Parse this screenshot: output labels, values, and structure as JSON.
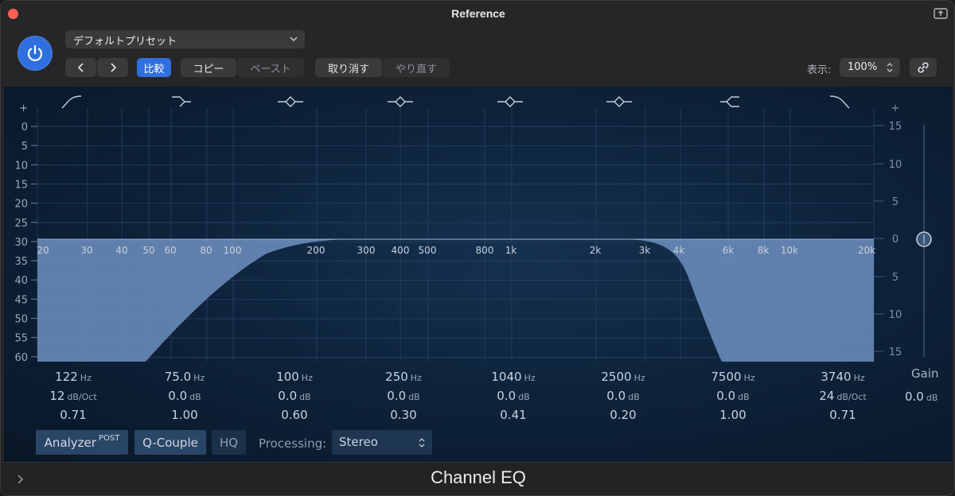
{
  "window": {
    "title": "Reference"
  },
  "header": {
    "preset": "デフォルトプリセット",
    "compare_label": "比較",
    "copy_label": "コピー",
    "paste_label": "ペースト",
    "undo_label": "取り消す",
    "redo_label": "やり直す",
    "zoom_label": "表示:",
    "zoom_value": "100%"
  },
  "graph": {
    "left_scale": [
      "+",
      "0",
      "5",
      "10",
      "15",
      "20",
      "25",
      "30",
      "35",
      "40",
      "45",
      "50",
      "55",
      "60"
    ],
    "right_scale": [
      "+",
      "15",
      "10",
      "5",
      "0",
      "5",
      "10",
      "15"
    ],
    "freq_labels": [
      "20",
      "30",
      "40",
      "50",
      "60",
      "80",
      "100",
      "200",
      "300",
      "400",
      "500",
      "800",
      "1k",
      "2k",
      "3k",
      "4k",
      "6k",
      "8k",
      "10k",
      "20k"
    ],
    "band_icons": [
      "low-cut-icon",
      "low-shelf-icon",
      "bell-icon",
      "bell-icon",
      "bell-icon",
      "bell-icon",
      "high-shelf-icon",
      "high-cut-icon"
    ]
  },
  "bands": [
    {
      "freq": "122",
      "freq_unit": "Hz",
      "gain": "12",
      "gain_unit": "dB/Oct",
      "q": "0.71"
    },
    {
      "freq": "75.0",
      "freq_unit": "Hz",
      "gain": "0.0",
      "gain_unit": "dB",
      "q": "1.00"
    },
    {
      "freq": "100",
      "freq_unit": "Hz",
      "gain": "0.0",
      "gain_unit": "dB",
      "q": "0.60"
    },
    {
      "freq": "250",
      "freq_unit": "Hz",
      "gain": "0.0",
      "gain_unit": "dB",
      "q": "0.30"
    },
    {
      "freq": "1040",
      "freq_unit": "Hz",
      "gain": "0.0",
      "gain_unit": "dB",
      "q": "0.41"
    },
    {
      "freq": "2500",
      "freq_unit": "Hz",
      "gain": "0.0",
      "gain_unit": "dB",
      "q": "0.20"
    },
    {
      "freq": "7500",
      "freq_unit": "Hz",
      "gain": "0.0",
      "gain_unit": "dB",
      "q": "1.00"
    },
    {
      "freq": "3740",
      "freq_unit": "Hz",
      "gain": "24",
      "gain_unit": "dB/Oct",
      "q": "0.71"
    }
  ],
  "master_gain": {
    "label": "Gain",
    "value": "0.0",
    "unit": "dB"
  },
  "options": {
    "analyzer_label": "Analyzer",
    "analyzer_sup": "POST",
    "qcouple_label": "Q-Couple",
    "hq_label": "HQ",
    "processing_label": "Processing:",
    "processing_value": "Stereo"
  },
  "footer": {
    "title": "Channel EQ"
  },
  "colors": {
    "accent": "#2f6fe0",
    "curve_fill": "#6f8fbf",
    "panel_bg": "#0d2138"
  }
}
